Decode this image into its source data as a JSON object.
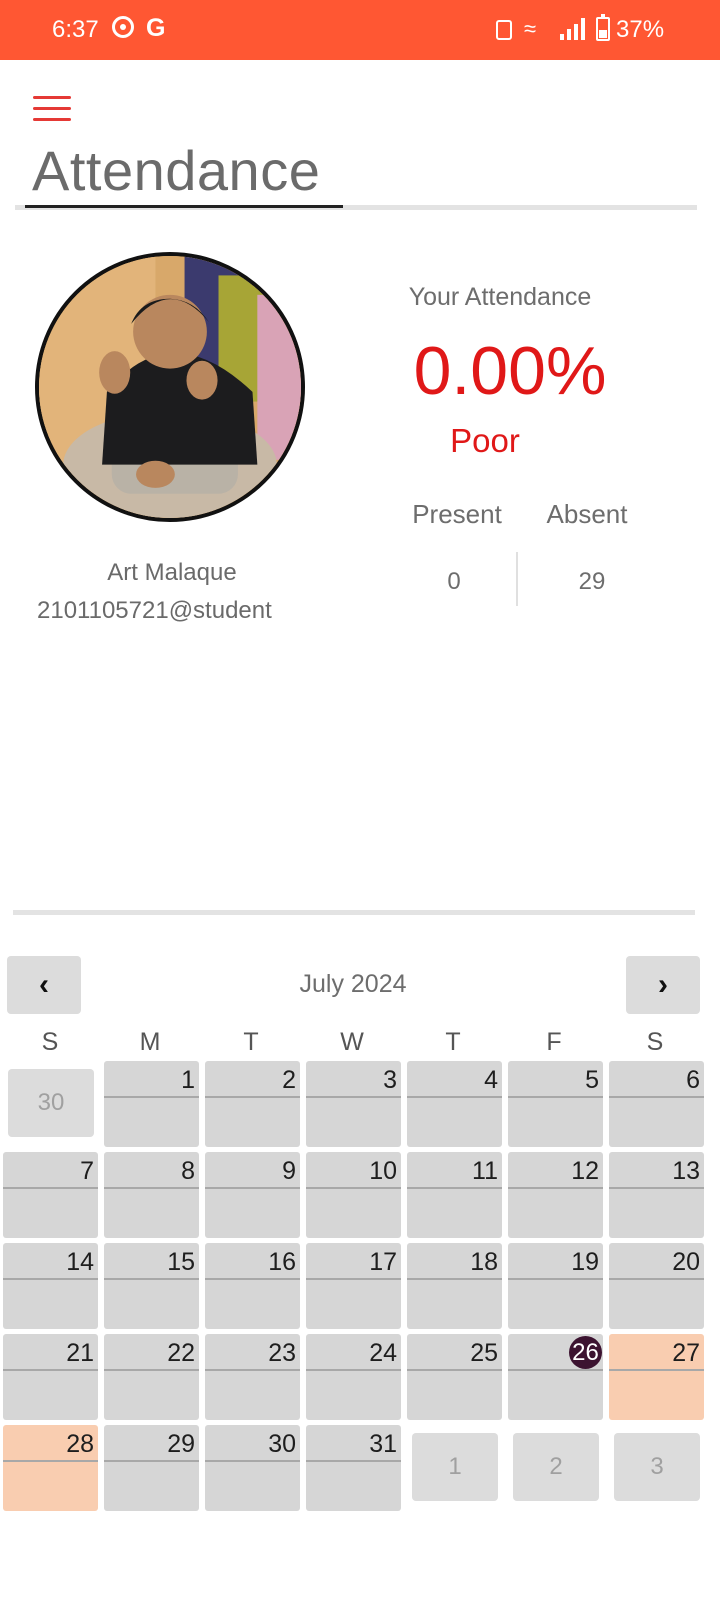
{
  "status_bar": {
    "time": "6:37",
    "app_letter": "G",
    "battery_percent": "37%",
    "background_color": "#ff5733"
  },
  "header": {
    "menu_icon": "hamburger-icon",
    "title": "Attendance"
  },
  "profile": {
    "name": "Art Malaque",
    "email": "2101105721@student"
  },
  "attendance": {
    "label": "Your Attendance",
    "percent": "0.00%",
    "rating": "Poor",
    "present_label": "Present",
    "absent_label": "Absent",
    "present_value": "0",
    "absent_value": "29",
    "accent_color": "#e01818"
  },
  "calendar": {
    "month": "July 2024",
    "prev_label": "‹",
    "next_label": "›",
    "weekdays": [
      "S",
      "M",
      "T",
      "W",
      "T",
      "F",
      "S"
    ],
    "leading_days": [
      "30"
    ],
    "days": [
      "1",
      "2",
      "3",
      "4",
      "5",
      "6",
      "7",
      "8",
      "9",
      "10",
      "11",
      "12",
      "13",
      "14",
      "15",
      "16",
      "17",
      "18",
      "19",
      "20",
      "21",
      "22",
      "23",
      "24",
      "25",
      "26",
      "27",
      "28",
      "29",
      "30",
      "31"
    ],
    "trailing_days": [
      "1",
      "2",
      "3"
    ],
    "today": "26",
    "highlighted_days": [
      "27",
      "28"
    ],
    "today_color": "#3c1330",
    "highlight_color": "#f9cdb0"
  }
}
